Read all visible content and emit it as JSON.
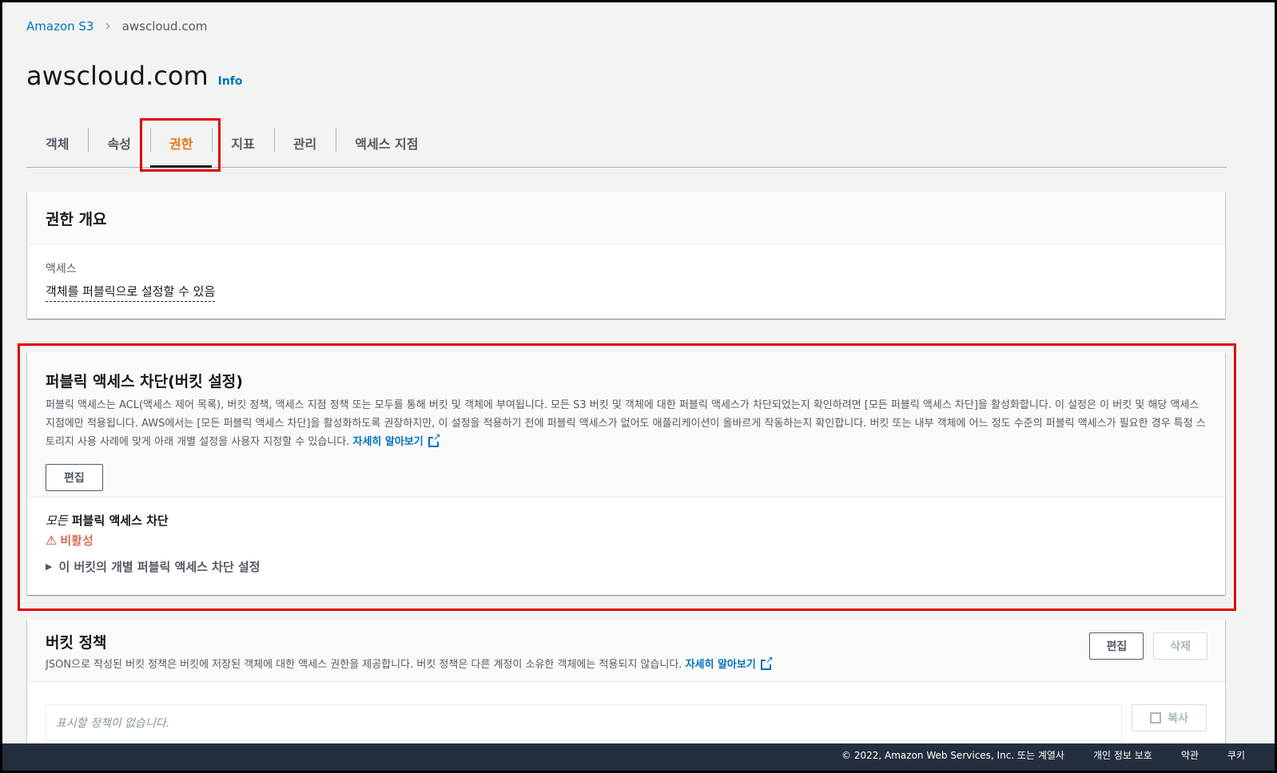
{
  "breadcrumb": {
    "root": "Amazon S3",
    "current": "awscloud.com"
  },
  "title": "awscloud.com",
  "info_label": "Info",
  "tabs": [
    {
      "label": "객체",
      "active": false
    },
    {
      "label": "속성",
      "active": false
    },
    {
      "label": "권한",
      "active": true
    },
    {
      "label": "지표",
      "active": false
    },
    {
      "label": "관리",
      "active": false
    },
    {
      "label": "액세스 지점",
      "active": false
    }
  ],
  "overview": {
    "title": "권한 개요",
    "access_label": "액세스",
    "access_value": "객체를 퍼블릭으로 설정할 수 있음"
  },
  "block_public": {
    "title": "퍼블릭 액세스 차단(버킷 설정)",
    "description": "퍼블릭 액세스는 ACL(액세스 제어 목록), 버킷 정책, 액세스 지점 정책 또는 모두를 통해 버킷 및 객체에 부여됩니다. 모든 S3 버킷 및 객체에 대한 퍼블릭 액세스가 차단되었는지 확인하려면 [모든 퍼블릭 액세스 차단]을 활성화합니다. 이 설정은 이 버킷 및 해당 액세스 지점에만 적용됩니다. AWS에서는 [모든 퍼블릭 액세스 차단]을 활성화하도록 권장하지만, 이 설정을 적용하기 전에 퍼블릭 액세스가 없어도 애플리케이션이 올바르게 작동하는지 확인합니다. 버킷 또는 내부 객체에 어느 정도 수준의 퍼블릭 액세스가 필요한 경우 특정 스토리지 사용 사례에 맞게 아래 개별 설정을 사용자 지정할 수 있습니다.",
    "learn_more": "자세히 알아보기",
    "edit_label": "편집",
    "all_prefix": "모든",
    "all_title": "퍼블릭 액세스 차단",
    "status": "비활성",
    "expander": "이 버킷의 개별 퍼블릭 액세스 차단 설정"
  },
  "bucket_policy": {
    "title": "버킷 정책",
    "description": "JSON으로 작성된 버킷 정책은 버킷에 저장된 객체에 대한 액세스 권한을 제공합니다. 버킷 정책은 다른 계정이 소유한 객체에는 적용되지 않습니다.",
    "learn_more": "자세히 알아보기",
    "edit_label": "편집",
    "delete_label": "삭제",
    "empty_text": "표시할 정책이 없습니다.",
    "copy_label": "복사"
  },
  "footer": {
    "copyright": "© 2022, Amazon Web Services, Inc. 또는 계열사",
    "privacy": "개인 정보 보호",
    "terms": "약관",
    "cookie": "쿠키"
  },
  "colors": {
    "link": "#0073bb",
    "active_tab": "#ec7211",
    "error": "#d13212",
    "highlight": "#e00000"
  }
}
